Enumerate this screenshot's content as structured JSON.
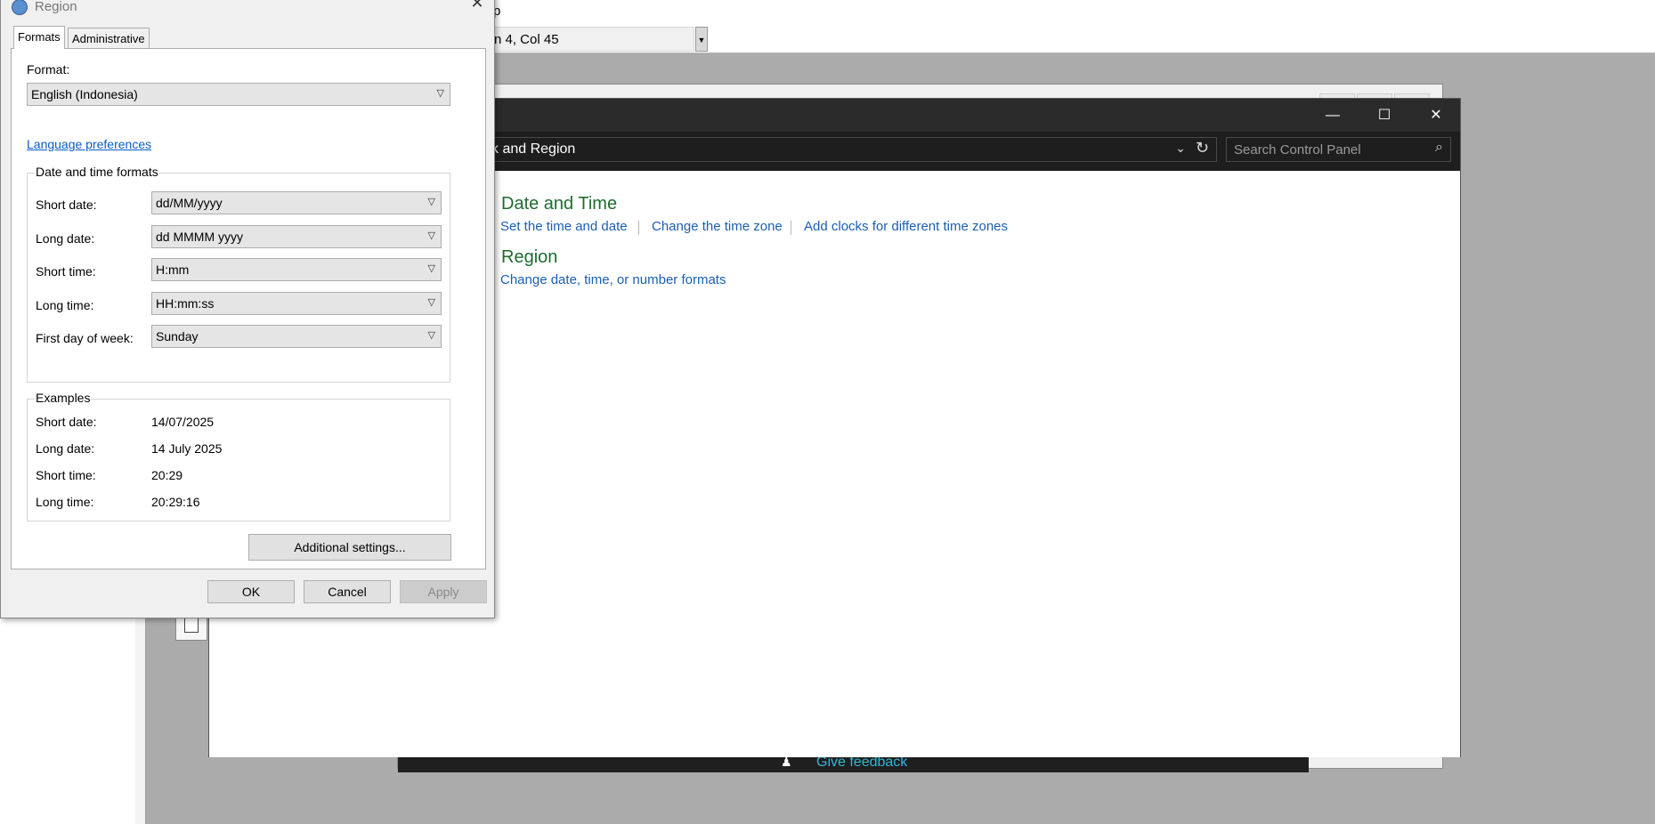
{
  "background_app": {
    "menu_fragment": "p",
    "status_text": "n 4, Col 45",
    "feedback_label": "Give feedback"
  },
  "control_panel": {
    "address_text": "ck and Region",
    "search_placeholder": "Search Control Panel",
    "sections": [
      {
        "heading": "Date and Time",
        "links": [
          "Set the time and date",
          "Change the time zone",
          "Add clocks for different time zones"
        ]
      },
      {
        "heading": "Region",
        "links": [
          "Change date, time, or number formats"
        ]
      }
    ]
  },
  "region_dialog": {
    "title": "Region",
    "tabs": [
      "Formats",
      "Administrative"
    ],
    "active_tab": "Formats",
    "format_label": "Format:",
    "format_value": "English (Indonesia)",
    "language_link": "Language preferences",
    "date_time_group": {
      "title": "Date and time formats",
      "rows": [
        {
          "label": "Short date:",
          "value": "dd/MM/yyyy"
        },
        {
          "label": "Long date:",
          "value": "dd MMMM yyyy"
        },
        {
          "label": "Short time:",
          "value": "H:mm"
        },
        {
          "label": "Long time:",
          "value": "HH:mm:ss"
        },
        {
          "label": "First day of week:",
          "value": "Sunday"
        }
      ]
    },
    "examples_group": {
      "title": "Examples",
      "rows": [
        {
          "label": "Short date:",
          "value": "14/07/2025"
        },
        {
          "label": "Long date:",
          "value": "14 July 2025"
        },
        {
          "label": "Short time:",
          "value": "20:29"
        },
        {
          "label": "Long time:",
          "value": "20:29:16"
        }
      ]
    },
    "additional_settings_label": "Additional settings...",
    "ok_label": "OK",
    "cancel_label": "Cancel",
    "apply_label": "Apply"
  }
}
